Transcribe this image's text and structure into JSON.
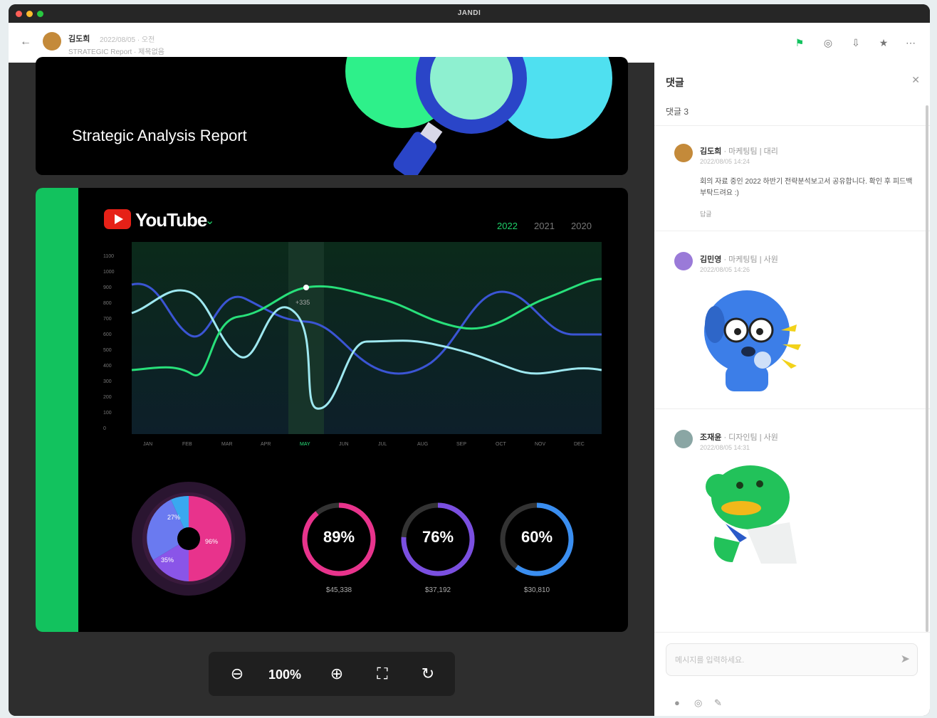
{
  "window": {
    "title": "JANDI"
  },
  "header": {
    "user_name": "김도희",
    "meta": "2022/08/05 · 오전",
    "file_name": "STRATEGIC Report · 제목없음"
  },
  "document": {
    "hero_title": "Strategic Analysis Report",
    "brand": "YouTube",
    "years": [
      "2022",
      "2021",
      "2020"
    ],
    "active_year": "2022",
    "tooltip": "+335",
    "rings": [
      {
        "value": "89%",
        "sub": "$45,338"
      },
      {
        "value": "76%",
        "sub": "$37,192"
      },
      {
        "value": "60%",
        "sub": "$30,810"
      }
    ],
    "donut_labels": [
      "27%",
      "96%",
      "35%"
    ],
    "chart": {
      "y_ticks": [
        "1100",
        "1000",
        "900",
        "800",
        "700",
        "600",
        "500",
        "400",
        "300",
        "200",
        "100",
        "0"
      ],
      "x_ticks": [
        "JAN",
        "FEB",
        "MAR",
        "APR",
        "MAY",
        "JUN",
        "JUL",
        "AUG",
        "SEP",
        "OCT",
        "NOV",
        "DEC"
      ]
    }
  },
  "zoom": {
    "level": "100%"
  },
  "panel": {
    "title": "댓글",
    "subtitle": "댓글 3",
    "comments": [
      {
        "name": "김도희",
        "role": "· 마케팅팀 | 대리",
        "date": "2022/08/05 14:24",
        "text": "회의 자료 중인 2022 하반기 전략분석보고서 공유합니다. 확인 후 피드백 부탁드려요 :)",
        "reply": "답글"
      },
      {
        "name": "김민영",
        "role": "· 마케팅팀 | 사원",
        "date": "2022/08/05 14:26",
        "text": "",
        "reply": ""
      },
      {
        "name": "조재윤",
        "role": "· 디자인팀 | 사원",
        "date": "2022/08/05 14:31",
        "text": "",
        "reply": ""
      }
    ],
    "input_placeholder": "메시지를 입력하세요."
  },
  "colors": {
    "accent_green": "#12c25e",
    "line_green": "#28e07a",
    "line_blue": "#3b55d4",
    "line_cyan": "#9ee8f0",
    "ring1": "#e8338c",
    "ring2": "#7a4fe0",
    "ring3": "#3a8ef0"
  }
}
